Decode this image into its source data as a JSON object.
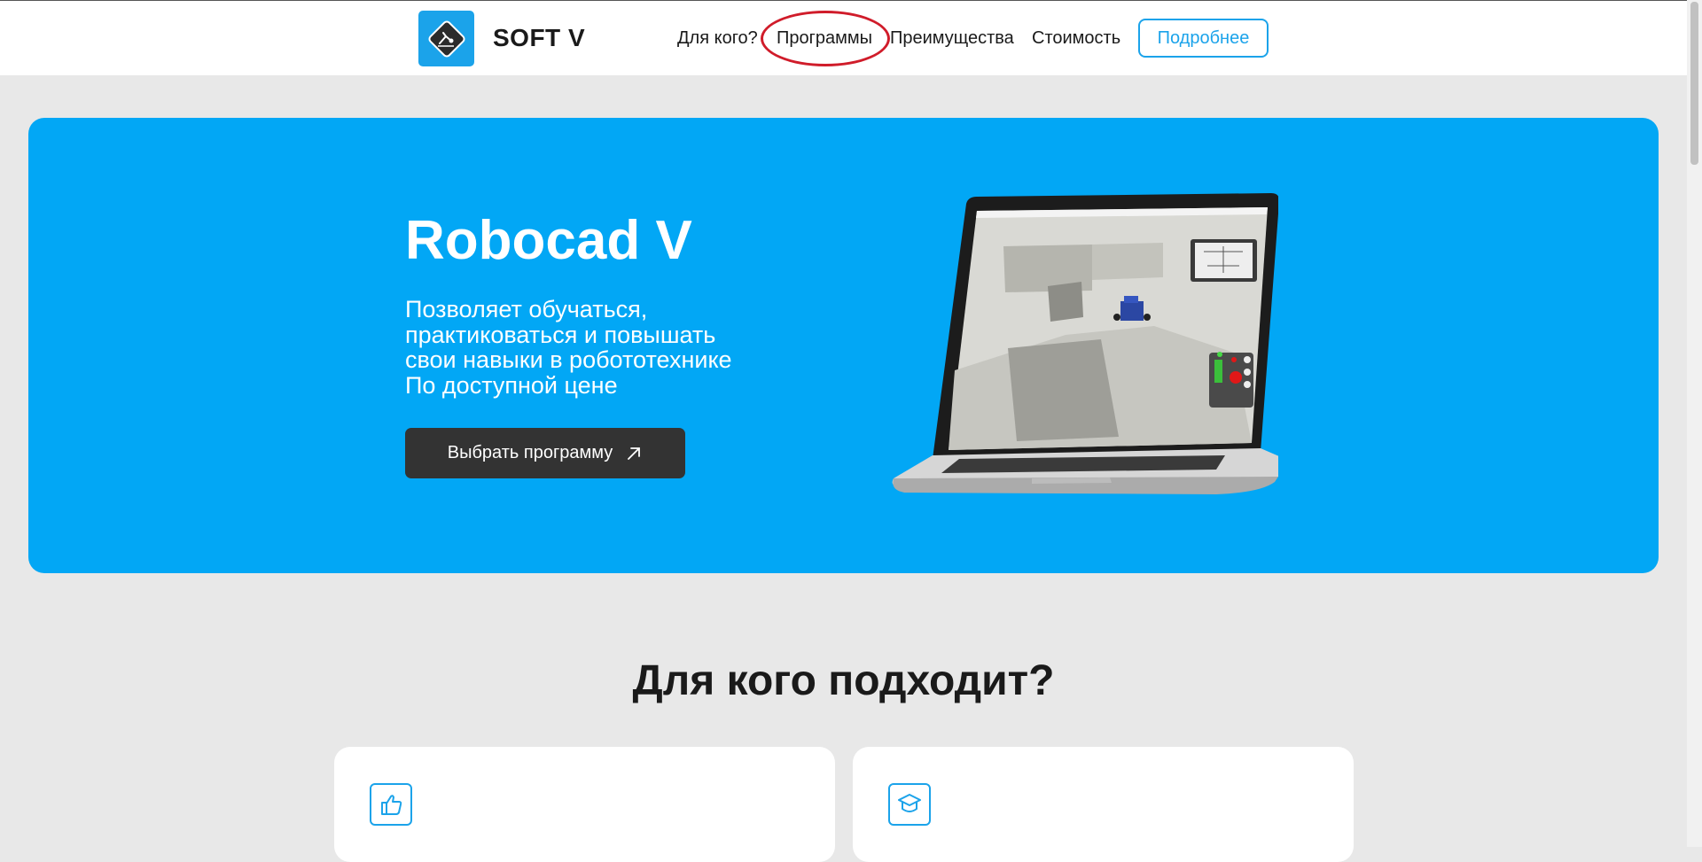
{
  "header": {
    "logo_text": "SOFT V",
    "logo_icon": "robot-arm-icon",
    "nav": [
      {
        "label": "Для кого?"
      },
      {
        "label": "Программы",
        "highlighted": true
      },
      {
        "label": "Преимущества"
      },
      {
        "label": "Стоимость"
      }
    ],
    "more_button": "Подробнее"
  },
  "hero": {
    "title": "Robocad V",
    "lines": [
      "Позволяет обучаться,",
      "практиковаться и повышать",
      "свои навыки в робототехнике",
      "По доступной цене"
    ],
    "cta_label": "Выбрать программу",
    "cta_icon": "arrow-up-right-icon",
    "image": "laptop-simulation-image"
  },
  "section": {
    "title": "Для кого подходит?",
    "cards": [
      {
        "icon": "thumbs-up-icon"
      },
      {
        "icon": "graduation-cap-icon"
      }
    ]
  },
  "colors": {
    "accent": "#02a7f5",
    "dark_button": "#333333",
    "highlight": "#d01c2a",
    "background": "#e8e8e8"
  }
}
